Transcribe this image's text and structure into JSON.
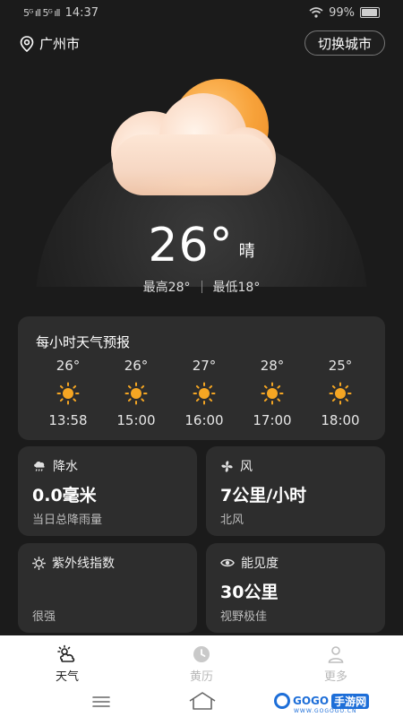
{
  "status_bar": {
    "signal": "5ᴳ ıll 5ᴳ ıll",
    "time": "14:37",
    "battery": "99%"
  },
  "header": {
    "city": "广州市",
    "switch_city_label": "切换城市"
  },
  "current": {
    "temperature": "26°",
    "condition": "晴",
    "high": "最高28°",
    "low": "最低18°"
  },
  "hourly": {
    "title": "每小时天气预报",
    "items": [
      {
        "temp": "26°",
        "time": "13:58",
        "icon": "sun-icon"
      },
      {
        "temp": "26°",
        "time": "15:00",
        "icon": "sun-icon"
      },
      {
        "temp": "27°",
        "time": "16:00",
        "icon": "sun-icon"
      },
      {
        "temp": "28°",
        "time": "17:00",
        "icon": "sun-icon"
      },
      {
        "temp": "25°",
        "time": "18:00",
        "icon": "sun-icon"
      }
    ]
  },
  "cards": {
    "precip": {
      "label": "降水",
      "value": "0.0毫米",
      "sub": "当日总降雨量",
      "icon": "rain-cloud-icon"
    },
    "wind": {
      "label": "风",
      "value": "7公里/小时",
      "sub": "北风",
      "icon": "fan-icon"
    },
    "uv": {
      "label": "紫外线指数",
      "value": "",
      "sub": "很强",
      "icon": "uv-sun-icon"
    },
    "visibility": {
      "label": "能见度",
      "value": "30公里",
      "sub": "视野极佳",
      "icon": "eye-icon"
    }
  },
  "tabs": [
    {
      "label": "天气",
      "icon": "weather-icon",
      "active": true
    },
    {
      "label": "黄历",
      "icon": "clock-icon",
      "active": false
    },
    {
      "label": "更多",
      "icon": "user-icon",
      "active": false
    }
  ],
  "watermark": {
    "brand": "GOGO",
    "suffix": "手游网",
    "sub": "WWW.GOGOGO.CN"
  },
  "colors": {
    "background": "#1b1b1b",
    "card": "#2d2d2d",
    "sun": "#f7a23a",
    "hourly_icon": "#f5a623",
    "watermark": "#1d6ed8"
  }
}
